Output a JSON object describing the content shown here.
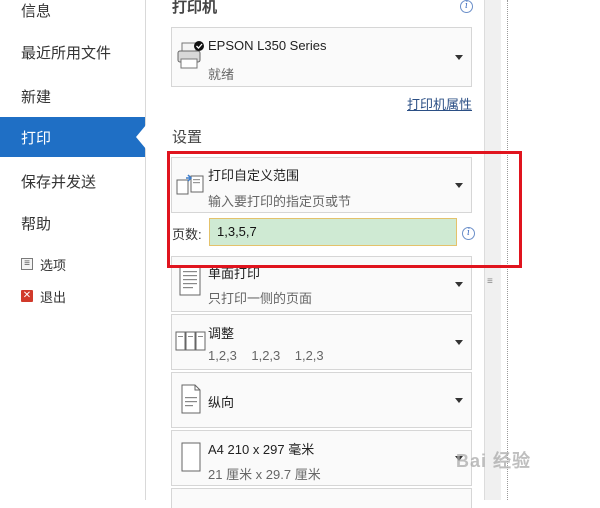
{
  "nav": {
    "info": "信息",
    "recent": "最近所用文件",
    "new": "新建",
    "print": "打印",
    "save_send": "保存并发送",
    "help": "帮助",
    "options": "选项",
    "exit": "退出"
  },
  "printer": {
    "section_title": "打印机",
    "name": "EPSON L350 Series",
    "status": "就绪",
    "properties_link": "打印机属性"
  },
  "settings": {
    "section_title": "设置",
    "range": {
      "main": "打印自定义范围",
      "sub": "输入要打印的指定页或节"
    },
    "pages_label": "页数:",
    "pages_value": "1,3,5,7",
    "sides": {
      "main": "单面打印",
      "sub": "只打印一侧的页面"
    },
    "collate": {
      "main": "调整",
      "sub": "1,2,3    1,2,3    1,2,3"
    },
    "orientation": {
      "main": "纵向"
    },
    "paper": {
      "main": "A4 210 x 297 毫米",
      "sub": "21 厘米 x 29.7 厘米"
    }
  },
  "watermark": "Bai 经验",
  "colors": {
    "nav_active": "#1f6fc5",
    "highlight": "#e0141e",
    "pages_input_bg": "#cfead3"
  }
}
